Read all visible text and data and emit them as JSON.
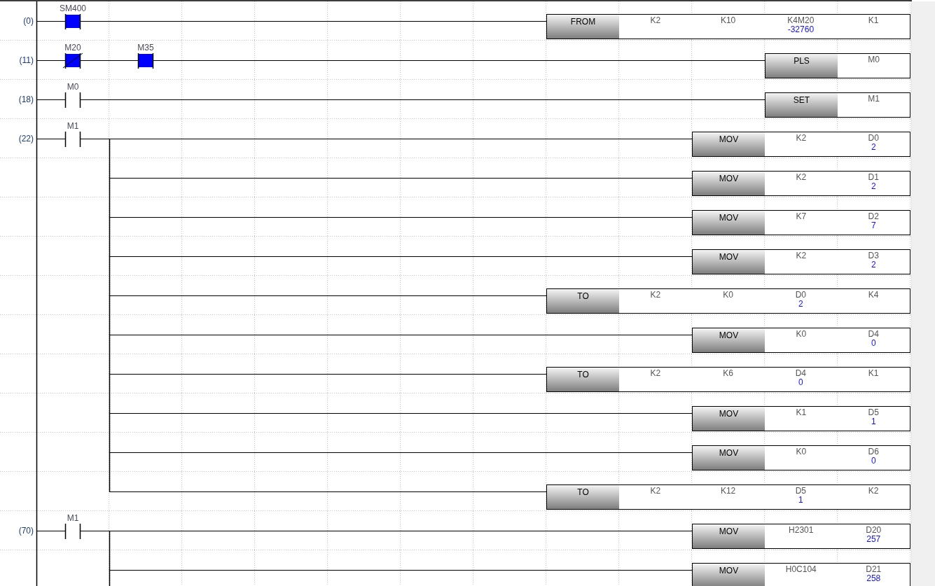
{
  "rungs": [
    {
      "step": "(0)",
      "contacts": [
        {
          "label": "SM400",
          "kind": "open",
          "on": true
        }
      ],
      "instruction": {
        "name": "FROM",
        "operands": [
          {
            "text": "K2"
          },
          {
            "text": "K10"
          },
          {
            "text": "K4M20",
            "value": "-32760"
          },
          {
            "text": "K1"
          }
        ]
      }
    },
    {
      "step": "(11)",
      "contacts": [
        {
          "label": "M20",
          "kind": "closed",
          "on": true
        },
        {
          "label": "M35",
          "kind": "open",
          "on": true
        }
      ],
      "instruction": {
        "name": "PLS",
        "operands": [
          {
            "text": "M0"
          }
        ]
      }
    },
    {
      "step": "(18)",
      "contacts": [
        {
          "label": "M0",
          "kind": "open",
          "on": false
        }
      ],
      "instruction": {
        "name": "SET",
        "operands": [
          {
            "text": "M1"
          }
        ]
      }
    },
    {
      "step": "(22)",
      "contacts": [
        {
          "label": "M1",
          "kind": "open",
          "on": false
        }
      ],
      "instruction": {
        "name": "MOV",
        "operands": [
          {
            "text": "K2"
          },
          {
            "text": "D0",
            "value": "2"
          }
        ]
      }
    },
    {
      "branch": true,
      "instruction": {
        "name": "MOV",
        "operands": [
          {
            "text": "K2"
          },
          {
            "text": "D1",
            "value": "2"
          }
        ]
      }
    },
    {
      "branch": true,
      "instruction": {
        "name": "MOV",
        "operands": [
          {
            "text": "K7"
          },
          {
            "text": "D2",
            "value": "7"
          }
        ]
      }
    },
    {
      "branch": true,
      "instruction": {
        "name": "MOV",
        "operands": [
          {
            "text": "K2"
          },
          {
            "text": "D3",
            "value": "2"
          }
        ]
      }
    },
    {
      "branch": true,
      "instruction": {
        "name": "TO",
        "operands": [
          {
            "text": "K2"
          },
          {
            "text": "K0"
          },
          {
            "text": "D0",
            "value": "2"
          },
          {
            "text": "K4"
          }
        ]
      }
    },
    {
      "branch": true,
      "instruction": {
        "name": "MOV",
        "operands": [
          {
            "text": "K0"
          },
          {
            "text": "D4",
            "value": "0"
          }
        ]
      }
    },
    {
      "branch": true,
      "instruction": {
        "name": "TO",
        "operands": [
          {
            "text": "K2"
          },
          {
            "text": "K6"
          },
          {
            "text": "D4",
            "value": "0"
          },
          {
            "text": "K1"
          }
        ]
      }
    },
    {
      "branch": true,
      "instruction": {
        "name": "MOV",
        "operands": [
          {
            "text": "K1"
          },
          {
            "text": "D5",
            "value": "1"
          }
        ]
      }
    },
    {
      "branch": true,
      "instruction": {
        "name": "MOV",
        "operands": [
          {
            "text": "K0"
          },
          {
            "text": "D6",
            "value": "0"
          }
        ]
      }
    },
    {
      "branch": true,
      "instruction": {
        "name": "TO",
        "operands": [
          {
            "text": "K2"
          },
          {
            "text": "K12"
          },
          {
            "text": "D5",
            "value": "1"
          },
          {
            "text": "K2"
          }
        ]
      }
    },
    {
      "step": "(70)",
      "contacts": [
        {
          "label": "M1",
          "kind": "open",
          "on": false
        }
      ],
      "instruction": {
        "name": "MOV",
        "operands": [
          {
            "text": "H2301"
          },
          {
            "text": "D20",
            "value": "257"
          }
        ]
      }
    },
    {
      "branch": true,
      "instruction": {
        "name": "MOV",
        "operands": [
          {
            "text": "H0C104"
          },
          {
            "text": "D21",
            "value": "258"
          }
        ]
      }
    }
  ]
}
